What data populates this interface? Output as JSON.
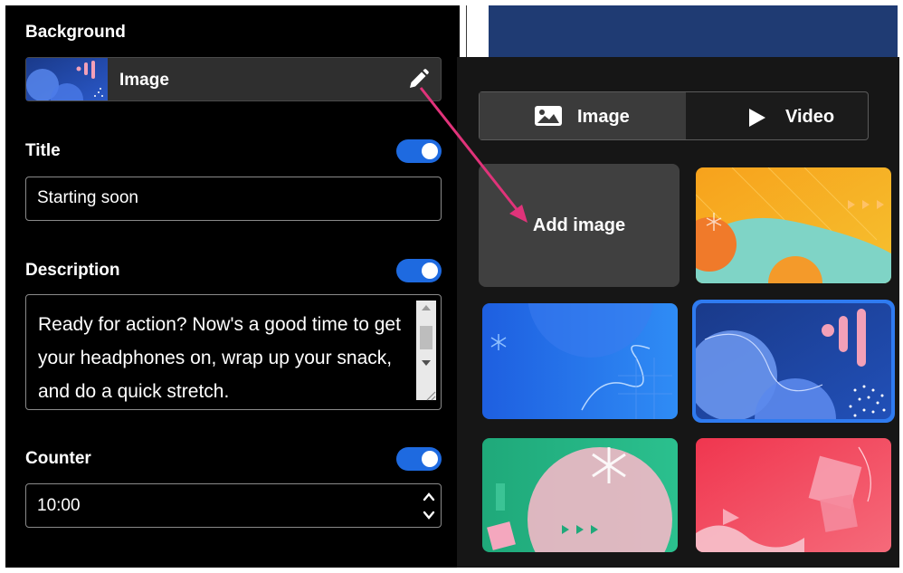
{
  "background": {
    "label": "Background",
    "value": "Image"
  },
  "title": {
    "label": "Title",
    "value": "Starting soon",
    "enabled": true
  },
  "description": {
    "label": "Description",
    "value": "Ready for action? Now's a good time to get your headphones on, wrap up your snack, and do a quick stretch.",
    "enabled": true
  },
  "counter": {
    "label": "Counter",
    "value": "10:00",
    "enabled": true
  },
  "picker": {
    "tabs": [
      {
        "label": "Image",
        "icon": "image-icon",
        "selected": true
      },
      {
        "label": "Video",
        "icon": "play-icon",
        "selected": false
      }
    ],
    "add_label": "Add image",
    "thumbnails": [
      {
        "name": "orange-wave",
        "selected": false
      },
      {
        "name": "blue-squiggle",
        "selected": false
      },
      {
        "name": "navy-circles",
        "selected": true
      },
      {
        "name": "green-asterisk",
        "selected": false
      },
      {
        "name": "red-shapes",
        "selected": false
      }
    ]
  },
  "colors": {
    "accent": "#1e6ae0",
    "annotation": "#e0337a",
    "selected_border": "#2f7bf0"
  }
}
